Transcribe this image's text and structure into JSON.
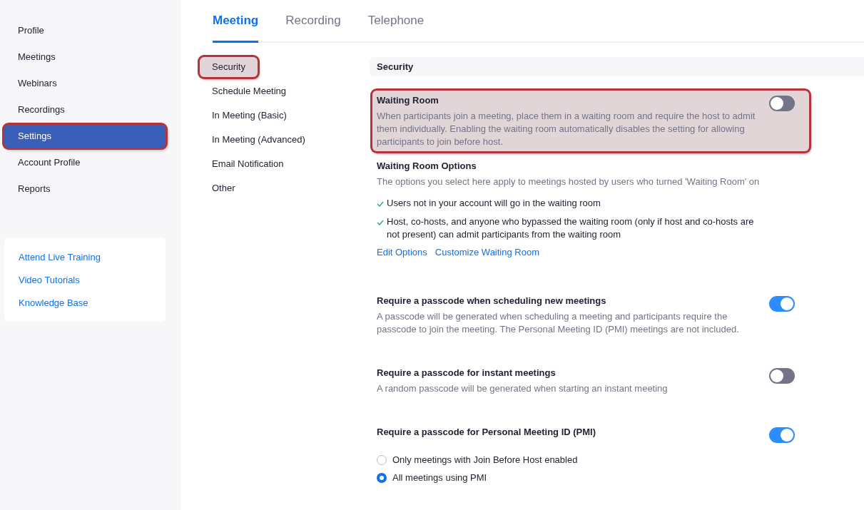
{
  "sidebar": {
    "items": [
      {
        "label": "Profile",
        "selected": false,
        "highlighted": false
      },
      {
        "label": "Meetings",
        "selected": false,
        "highlighted": false
      },
      {
        "label": "Webinars",
        "selected": false,
        "highlighted": false
      },
      {
        "label": "Recordings",
        "selected": false,
        "highlighted": false
      },
      {
        "label": "Settings",
        "selected": true,
        "highlighted": true
      },
      {
        "label": "Account Profile",
        "selected": false,
        "highlighted": false
      },
      {
        "label": "Reports",
        "selected": false,
        "highlighted": false
      }
    ],
    "help_links": [
      "Attend Live Training",
      "Video Tutorials",
      "Knowledge Base"
    ]
  },
  "tabs": [
    {
      "label": "Meeting",
      "selected": true
    },
    {
      "label": "Recording",
      "selected": false
    },
    {
      "label": "Telephone",
      "selected": false
    }
  ],
  "subnav": [
    {
      "label": "Security",
      "highlighted": true
    },
    {
      "label": "Schedule Meeting",
      "highlighted": false
    },
    {
      "label": "In Meeting (Basic)",
      "highlighted": false
    },
    {
      "label": "In Meeting (Advanced)",
      "highlighted": false
    },
    {
      "label": "Email Notification",
      "highlighted": false
    },
    {
      "label": "Other",
      "highlighted": false
    }
  ],
  "section_title": "Security",
  "settings": [
    {
      "kind": "toggle",
      "title": "Waiting Room",
      "description": "When participants join a meeting, place them in a waiting room and require the host to admit them individually. Enabling the waiting room automatically disables the setting for allowing participants to join before host.",
      "on": false,
      "highlighted": true
    },
    {
      "kind": "options",
      "title": "Waiting Room Options",
      "description": "The options you select here apply to meetings hosted by users who turned 'Waiting Room' on",
      "checks": [
        "Users not in your account will go in the waiting room",
        "Host, co-hosts, and anyone who bypassed the waiting room (only if host and co-hosts are not present) can admit participants from the waiting room"
      ],
      "links": [
        "Edit Options",
        "Customize Waiting Room"
      ]
    },
    {
      "kind": "toggle",
      "title": "Require a passcode when scheduling new meetings",
      "description": "A passcode will be generated when scheduling a meeting and participants require the passcode to join the meeting. The Personal Meeting ID (PMI) meetings are not included.",
      "on": true,
      "highlighted": false
    },
    {
      "kind": "toggle",
      "title": "Require a passcode for instant meetings",
      "description": "A random passcode will be generated when starting an instant meeting",
      "on": false,
      "highlighted": false
    },
    {
      "kind": "toggle",
      "title": "Require a passcode for Personal Meeting ID (PMI)",
      "on": true,
      "highlighted": false,
      "radios": [
        {
          "label": "Only meetings with Join Before Host enabled",
          "selected": false
        },
        {
          "label": "All meetings using PMI",
          "selected": true
        }
      ]
    }
  ]
}
